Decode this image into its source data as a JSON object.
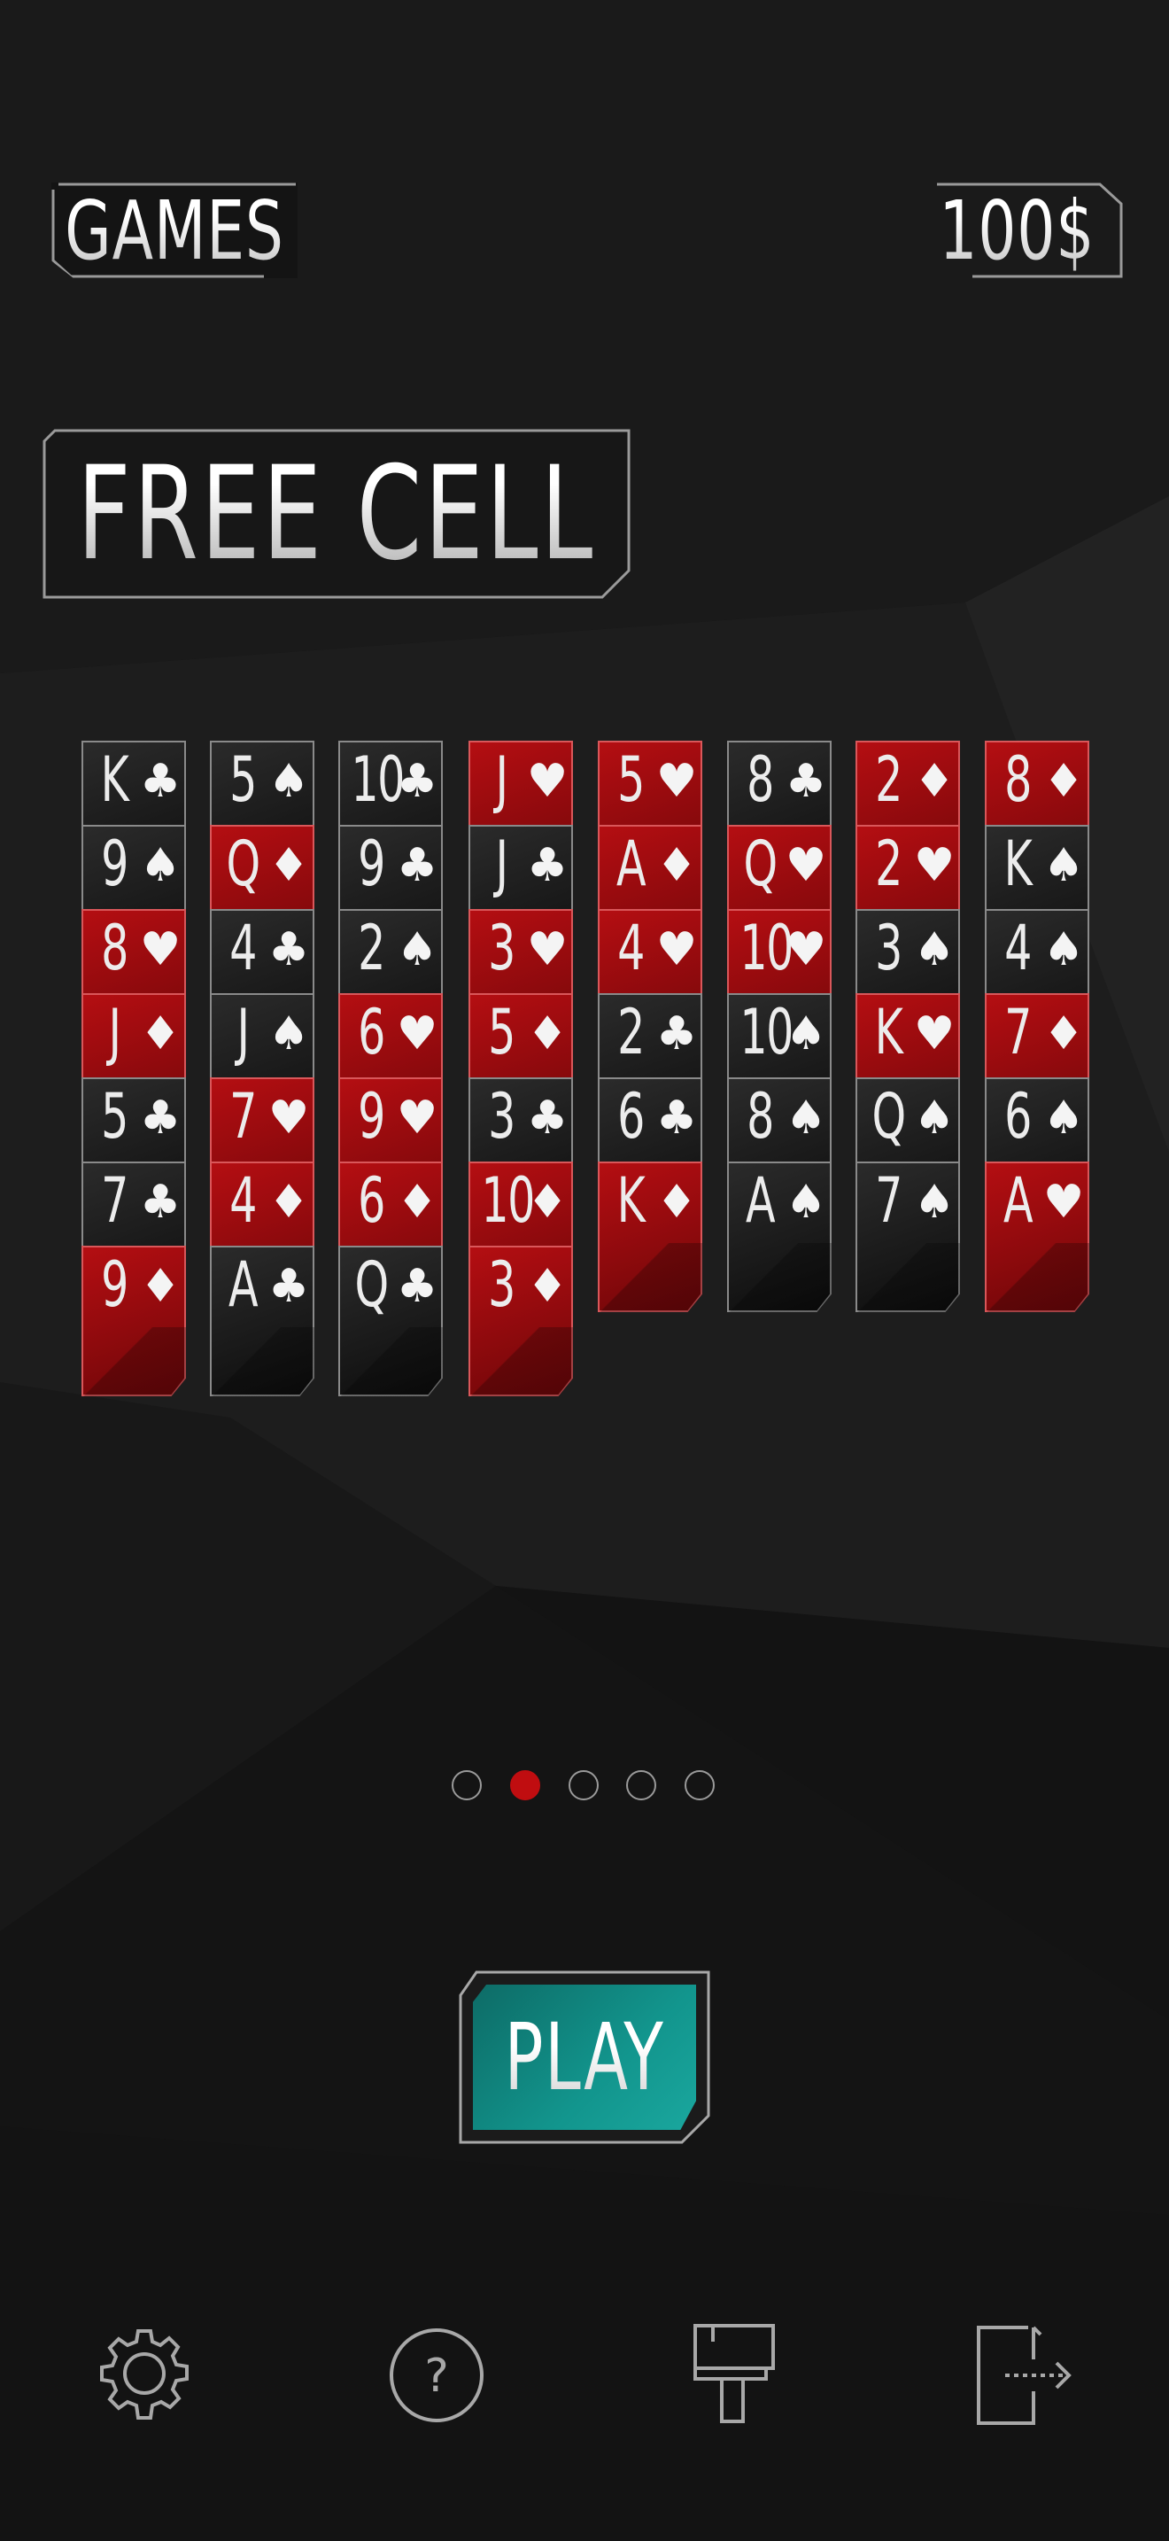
{
  "header": {
    "games_label": "GAMES",
    "balance": "100$"
  },
  "game_title": "FREE CELL",
  "preview": {
    "columns": [
      [
        {
          "rank": "K",
          "suit": "♣",
          "color": "black"
        },
        {
          "rank": "9",
          "suit": "♠",
          "color": "black"
        },
        {
          "rank": "8",
          "suit": "♥",
          "color": "red"
        },
        {
          "rank": "J",
          "suit": "♦",
          "color": "red"
        },
        {
          "rank": "5",
          "suit": "♣",
          "color": "black"
        },
        {
          "rank": "7",
          "suit": "♣",
          "color": "black"
        },
        {
          "rank": "9",
          "suit": "♦",
          "color": "red"
        }
      ],
      [
        {
          "rank": "5",
          "suit": "♠",
          "color": "black"
        },
        {
          "rank": "Q",
          "suit": "♦",
          "color": "red"
        },
        {
          "rank": "4",
          "suit": "♣",
          "color": "black"
        },
        {
          "rank": "J",
          "suit": "♠",
          "color": "black"
        },
        {
          "rank": "7",
          "suit": "♥",
          "color": "red"
        },
        {
          "rank": "4",
          "suit": "♦",
          "color": "red"
        },
        {
          "rank": "A",
          "suit": "♣",
          "color": "black"
        }
      ],
      [
        {
          "rank": "10",
          "suit": "♣",
          "color": "black"
        },
        {
          "rank": "9",
          "suit": "♣",
          "color": "black"
        },
        {
          "rank": "2",
          "suit": "♠",
          "color": "black"
        },
        {
          "rank": "6",
          "suit": "♥",
          "color": "red"
        },
        {
          "rank": "9",
          "suit": "♥",
          "color": "red"
        },
        {
          "rank": "6",
          "suit": "♦",
          "color": "red"
        },
        {
          "rank": "Q",
          "suit": "♣",
          "color": "black"
        }
      ],
      [
        {
          "rank": "J",
          "suit": "♥",
          "color": "red"
        },
        {
          "rank": "J",
          "suit": "♣",
          "color": "black"
        },
        {
          "rank": "3",
          "suit": "♥",
          "color": "red"
        },
        {
          "rank": "5",
          "suit": "♦",
          "color": "red"
        },
        {
          "rank": "3",
          "suit": "♣",
          "color": "black"
        },
        {
          "rank": "10",
          "suit": "♦",
          "color": "red"
        },
        {
          "rank": "3",
          "suit": "♦",
          "color": "red"
        }
      ],
      [
        {
          "rank": "5",
          "suit": "♥",
          "color": "red"
        },
        {
          "rank": "A",
          "suit": "♦",
          "color": "red"
        },
        {
          "rank": "4",
          "suit": "♥",
          "color": "red"
        },
        {
          "rank": "2",
          "suit": "♣",
          "color": "black"
        },
        {
          "rank": "6",
          "suit": "♣",
          "color": "black"
        },
        {
          "rank": "K",
          "suit": "♦",
          "color": "red"
        }
      ],
      [
        {
          "rank": "8",
          "suit": "♣",
          "color": "black"
        },
        {
          "rank": "Q",
          "suit": "♥",
          "color": "red"
        },
        {
          "rank": "10",
          "suit": "♥",
          "color": "red"
        },
        {
          "rank": "10",
          "suit": "♠",
          "color": "black"
        },
        {
          "rank": "8",
          "suit": "♠",
          "color": "black"
        },
        {
          "rank": "A",
          "suit": "♠",
          "color": "black"
        }
      ],
      [
        {
          "rank": "2",
          "suit": "♦",
          "color": "red"
        },
        {
          "rank": "2",
          "suit": "♥",
          "color": "red"
        },
        {
          "rank": "3",
          "suit": "♠",
          "color": "black"
        },
        {
          "rank": "K",
          "suit": "♥",
          "color": "red"
        },
        {
          "rank": "Q",
          "suit": "♠",
          "color": "black"
        },
        {
          "rank": "7",
          "suit": "♠",
          "color": "black"
        }
      ],
      [
        {
          "rank": "8",
          "suit": "♦",
          "color": "red"
        },
        {
          "rank": "K",
          "suit": "♠",
          "color": "black"
        },
        {
          "rank": "4",
          "suit": "♠",
          "color": "black"
        },
        {
          "rank": "7",
          "suit": "♦",
          "color": "red"
        },
        {
          "rank": "6",
          "suit": "♠",
          "color": "black"
        },
        {
          "rank": "A",
          "suit": "♥",
          "color": "red"
        }
      ]
    ]
  },
  "pagination": {
    "pages": 5,
    "current": 2
  },
  "play_label": "PLAY",
  "toolbar": [
    {
      "icon": "gear-icon"
    },
    {
      "icon": "help-icon"
    },
    {
      "icon": "paint-roller-icon"
    },
    {
      "icon": "exit-icon"
    }
  ],
  "colors": {
    "background": "#151515",
    "accent_red": "#c00d10",
    "play_teal": "#12958d",
    "frame": "#9a9a9a"
  }
}
